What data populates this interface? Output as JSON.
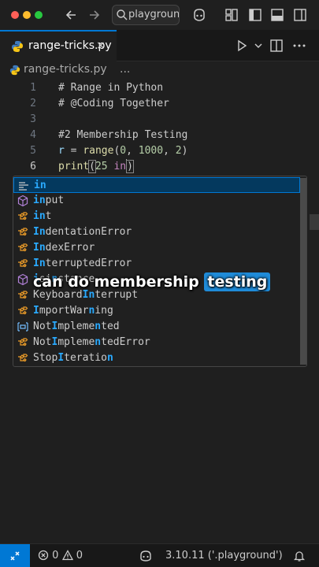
{
  "titlebar": {
    "search_text": "playground",
    "icons": [
      "back-arrow-icon",
      "forward-arrow-icon",
      "search-icon",
      "copilot-icon",
      "layout-icon",
      "panel-toggle-icon",
      "sidebar-toggle-icon"
    ]
  },
  "tab": {
    "filename": "range-tricks.py",
    "close": "×"
  },
  "breadcrumb": {
    "file": "range-tricks.py",
    "more": "..."
  },
  "editor": {
    "lines": [
      {
        "n": "1",
        "text": "# Range in Python"
      },
      {
        "n": "2",
        "text": "# @Coding Together"
      },
      {
        "n": "3",
        "text": ""
      },
      {
        "n": "4",
        "text": "#2 Membership Testing"
      },
      {
        "n": "5",
        "text": "r = range(0, 1000, 2)"
      },
      {
        "n": "6",
        "text": "print(25 in)"
      }
    ]
  },
  "suggest": {
    "items": [
      {
        "label": "in",
        "kind": "keyword"
      },
      {
        "label": "input",
        "kind": "function"
      },
      {
        "label": "int",
        "kind": "class"
      },
      {
        "label": "IndentationError",
        "kind": "class"
      },
      {
        "label": "IndexError",
        "kind": "class"
      },
      {
        "label": "InterruptedError",
        "kind": "class"
      },
      {
        "label": "isinstance",
        "kind": "function"
      },
      {
        "label": "KeyboardInterrupt",
        "kind": "class"
      },
      {
        "label": "ImportWarning",
        "kind": "class"
      },
      {
        "label": "NotImplemented",
        "kind": "variable"
      },
      {
        "label": "NotImplementedError",
        "kind": "class"
      },
      {
        "label": "StopIteration",
        "kind": "class"
      }
    ]
  },
  "caption": {
    "text": "can do membership ",
    "highlight": "testing"
  },
  "statusbar": {
    "errors": "0",
    "warnings": "0",
    "interpreter": "3.10.11 ('.playground')"
  },
  "colors": {
    "accent": "#0078d4",
    "match_highlight": "#2aaaff",
    "caption_highlight": "#1f8bd8"
  }
}
